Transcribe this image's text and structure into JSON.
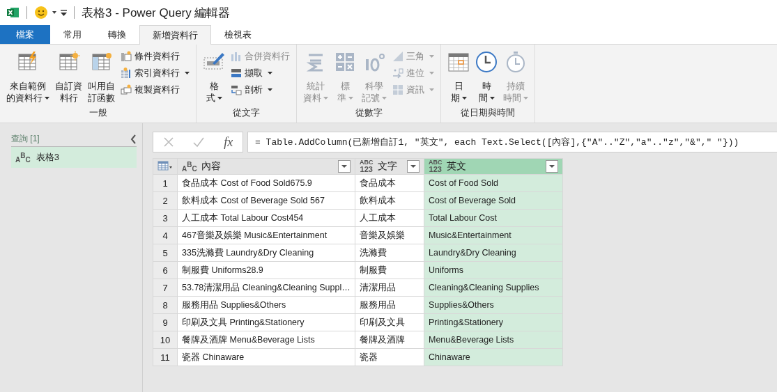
{
  "title": {
    "text": "表格3 - Power Query 編輯器"
  },
  "tabs": [
    {
      "label": "檔案",
      "kind": "file",
      "selected": false
    },
    {
      "label": "常用",
      "kind": "tab",
      "selected": false
    },
    {
      "label": "轉換",
      "kind": "tab",
      "selected": false
    },
    {
      "label": "新增資料行",
      "kind": "tab",
      "selected": true
    },
    {
      "label": "檢視表",
      "kind": "tab",
      "selected": false
    }
  ],
  "ribbon_groups": [
    {
      "label": "一般",
      "large_buttons": [
        {
          "lines": [
            "來自範例",
            "的資料行"
          ],
          "dropdown": true,
          "disabled": false
        },
        {
          "lines": [
            "自訂資",
            "料行"
          ],
          "dropdown": false,
          "disabled": false
        },
        {
          "lines": [
            "叫用自",
            "訂函數"
          ],
          "dropdown": false,
          "disabled": false
        }
      ],
      "small_buttons": [
        {
          "label": "條件資料行",
          "dropdown": false,
          "disabled": false
        },
        {
          "label": "索引資料行",
          "dropdown": true,
          "disabled": false
        },
        {
          "label": "複製資料行",
          "dropdown": false,
          "disabled": false
        }
      ]
    },
    {
      "label": "從文字",
      "large_buttons": [
        {
          "lines": [
            "格",
            "式"
          ],
          "dropdown": true,
          "disabled": false
        }
      ],
      "small_buttons": [
        {
          "label": "合併資料行",
          "dropdown": false,
          "disabled": true
        },
        {
          "label": "擷取",
          "dropdown": true,
          "disabled": false
        },
        {
          "label": "剖析",
          "dropdown": true,
          "disabled": false
        }
      ]
    },
    {
      "label": "從數字",
      "large_buttons": [
        {
          "lines": [
            "統計",
            "資料"
          ],
          "dropdown": true,
          "disabled": true
        },
        {
          "lines": [
            "標",
            "準"
          ],
          "dropdown": true,
          "disabled": true
        },
        {
          "lines": [
            "科學",
            "記號"
          ],
          "dropdown": true,
          "disabled": true
        }
      ],
      "small_buttons": [
        {
          "label": "三角",
          "dropdown": true,
          "disabled": true
        },
        {
          "label": "進位",
          "dropdown": true,
          "disabled": true
        },
        {
          "label": "資訊",
          "dropdown": true,
          "disabled": true
        }
      ]
    },
    {
      "label": "從日期與時間",
      "large_buttons": [
        {
          "lines": [
            "日",
            "期"
          ],
          "dropdown": true,
          "disabled": false
        },
        {
          "lines": [
            "時",
            "間"
          ],
          "dropdown": true,
          "disabled": false
        },
        {
          "lines": [
            "持續",
            "時間"
          ],
          "dropdown": true,
          "disabled": true
        }
      ]
    }
  ],
  "queries_pane": {
    "title": "查詢 [1]",
    "items": [
      {
        "name": "表格3",
        "type_lines": [
          "ABC"
        ],
        "selected": true
      }
    ]
  },
  "formula_bar": {
    "fx": "fx",
    "formula": "= Table.AddColumn(已新增自訂1, \"英文\", each Text.Select([內容],{\"A\"..\"Z\",\"a\"..\"z\",\"&\",\" \"}))"
  },
  "table": {
    "columns": [
      {
        "name": "內容",
        "kind": "text",
        "type_lines": [
          "ABC"
        ],
        "selected": false
      },
      {
        "name": "文字",
        "kind": "any",
        "type_lines": [
          "ABC",
          "123"
        ],
        "selected": false
      },
      {
        "name": "英文",
        "kind": "any",
        "type_lines": [
          "ABC",
          "123"
        ],
        "selected": true
      }
    ],
    "rows": [
      {
        "index": "1",
        "cells": [
          "食品成本 Cost of Food Sold675.9",
          "食品成本",
          "Cost of Food Sold"
        ]
      },
      {
        "index": "2",
        "cells": [
          "飲料成本 Cost of Beverage Sold 567",
          "飲料成本",
          "Cost of Beverage Sold"
        ]
      },
      {
        "index": "3",
        "cells": [
          "人工成本 Total Labour Cost454",
          "人工成本",
          "Total Labour Cost"
        ]
      },
      {
        "index": "4",
        "cells": [
          "467音樂及娛樂 Music&Entertainment",
          "音樂及娛樂",
          "Music&Entertainment"
        ]
      },
      {
        "index": "5",
        "cells": [
          "335洗滌費 Laundry&Dry Cleaning",
          "洗滌費",
          "Laundry&Dry Cleaning"
        ]
      },
      {
        "index": "6",
        "cells": [
          "制服費 Uniforms28.9",
          "制服費",
          "Uniforms"
        ]
      },
      {
        "index": "7",
        "cells": [
          "53.78清潔用品 Cleaning&Cleaning Suppl…",
          "清潔用品",
          "Cleaning&Cleaning Supplies"
        ]
      },
      {
        "index": "8",
        "cells": [
          "服務用品 Supplies&Others",
          "服務用品",
          "Supplies&Others"
        ]
      },
      {
        "index": "9",
        "cells": [
          "印刷及文具 Printing&Stationery",
          "印刷及文具",
          "Printing&Stationery"
        ]
      },
      {
        "index": "10",
        "cells": [
          "餐牌及酒牌 Menu&Beverage Lists",
          "餐牌及酒牌",
          "Menu&Beverage Lists"
        ]
      },
      {
        "index": "11",
        "cells": [
          "瓷器 Chinaware",
          "瓷器",
          "Chinaware"
        ]
      }
    ]
  }
}
